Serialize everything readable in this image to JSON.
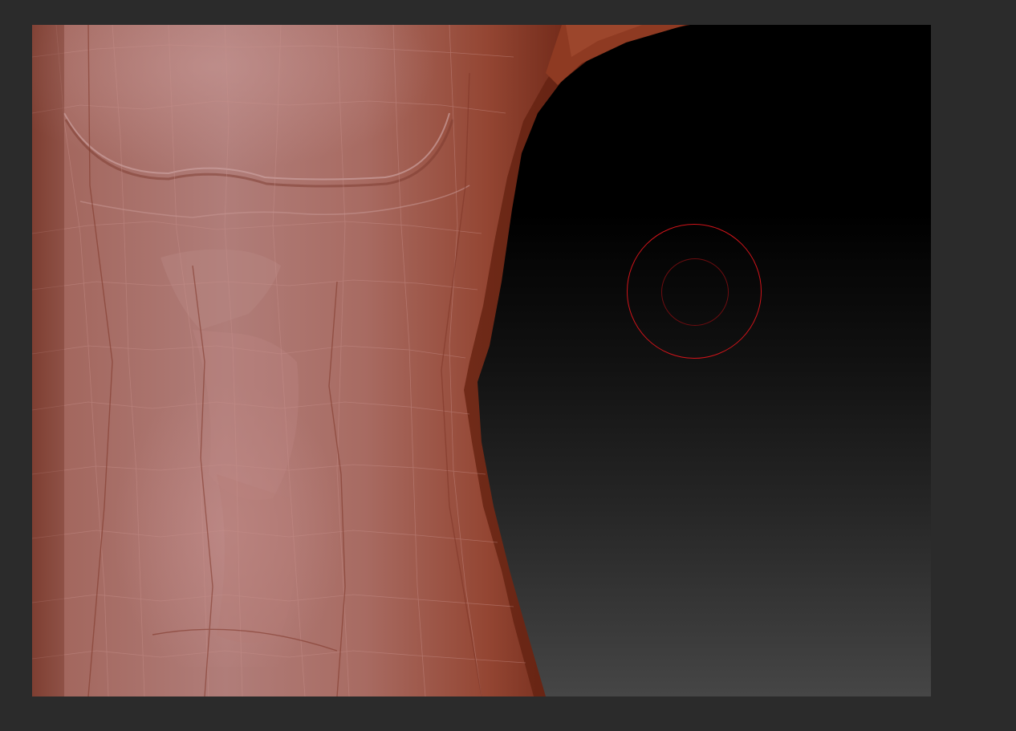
{
  "app": {
    "background_color": "#2b2b2b"
  },
  "viewport": {
    "content": "3d-sculpt-torso-mesh",
    "background_gradient": [
      "#000000",
      "#464646"
    ],
    "mesh_colors": {
      "base": "#a4685f",
      "shadow": "#7d2a1a",
      "rim": "#8e3a22",
      "highlight": "#c08a88"
    },
    "brush_cursor": {
      "outer_color": "#d0141a",
      "inner_color": "#6e0d10"
    }
  }
}
